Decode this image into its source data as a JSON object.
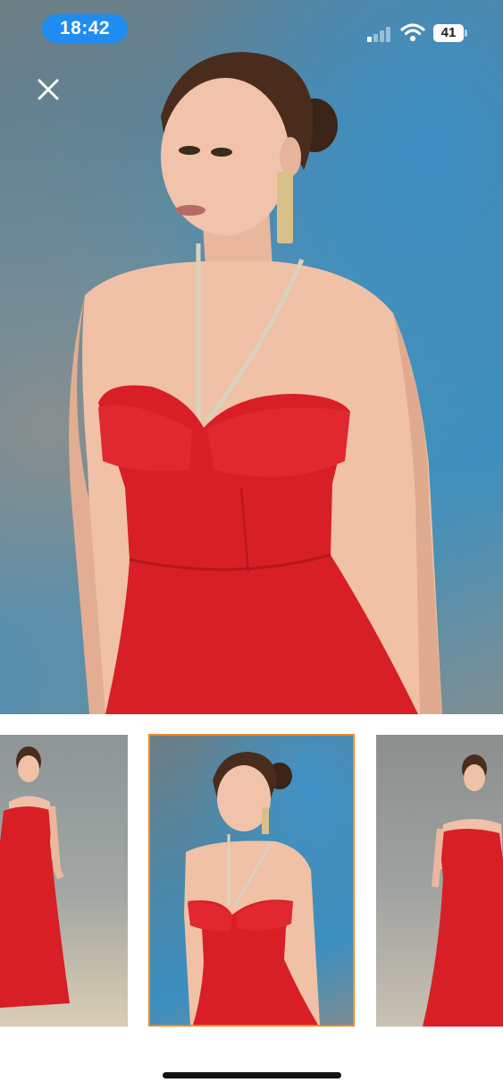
{
  "status_bar": {
    "time": "18:42",
    "battery_level": "41",
    "signal_bars_active": 1,
    "signal_bars_total": 4
  },
  "toolbar": {
    "close_icon": "close-icon"
  },
  "gallery": {
    "selected_index": 1,
    "thumbnail_count": 3,
    "accent_color": "#f08a24"
  },
  "colors": {
    "time_pill": "#1e8cf0",
    "dress": "#d81f26"
  }
}
